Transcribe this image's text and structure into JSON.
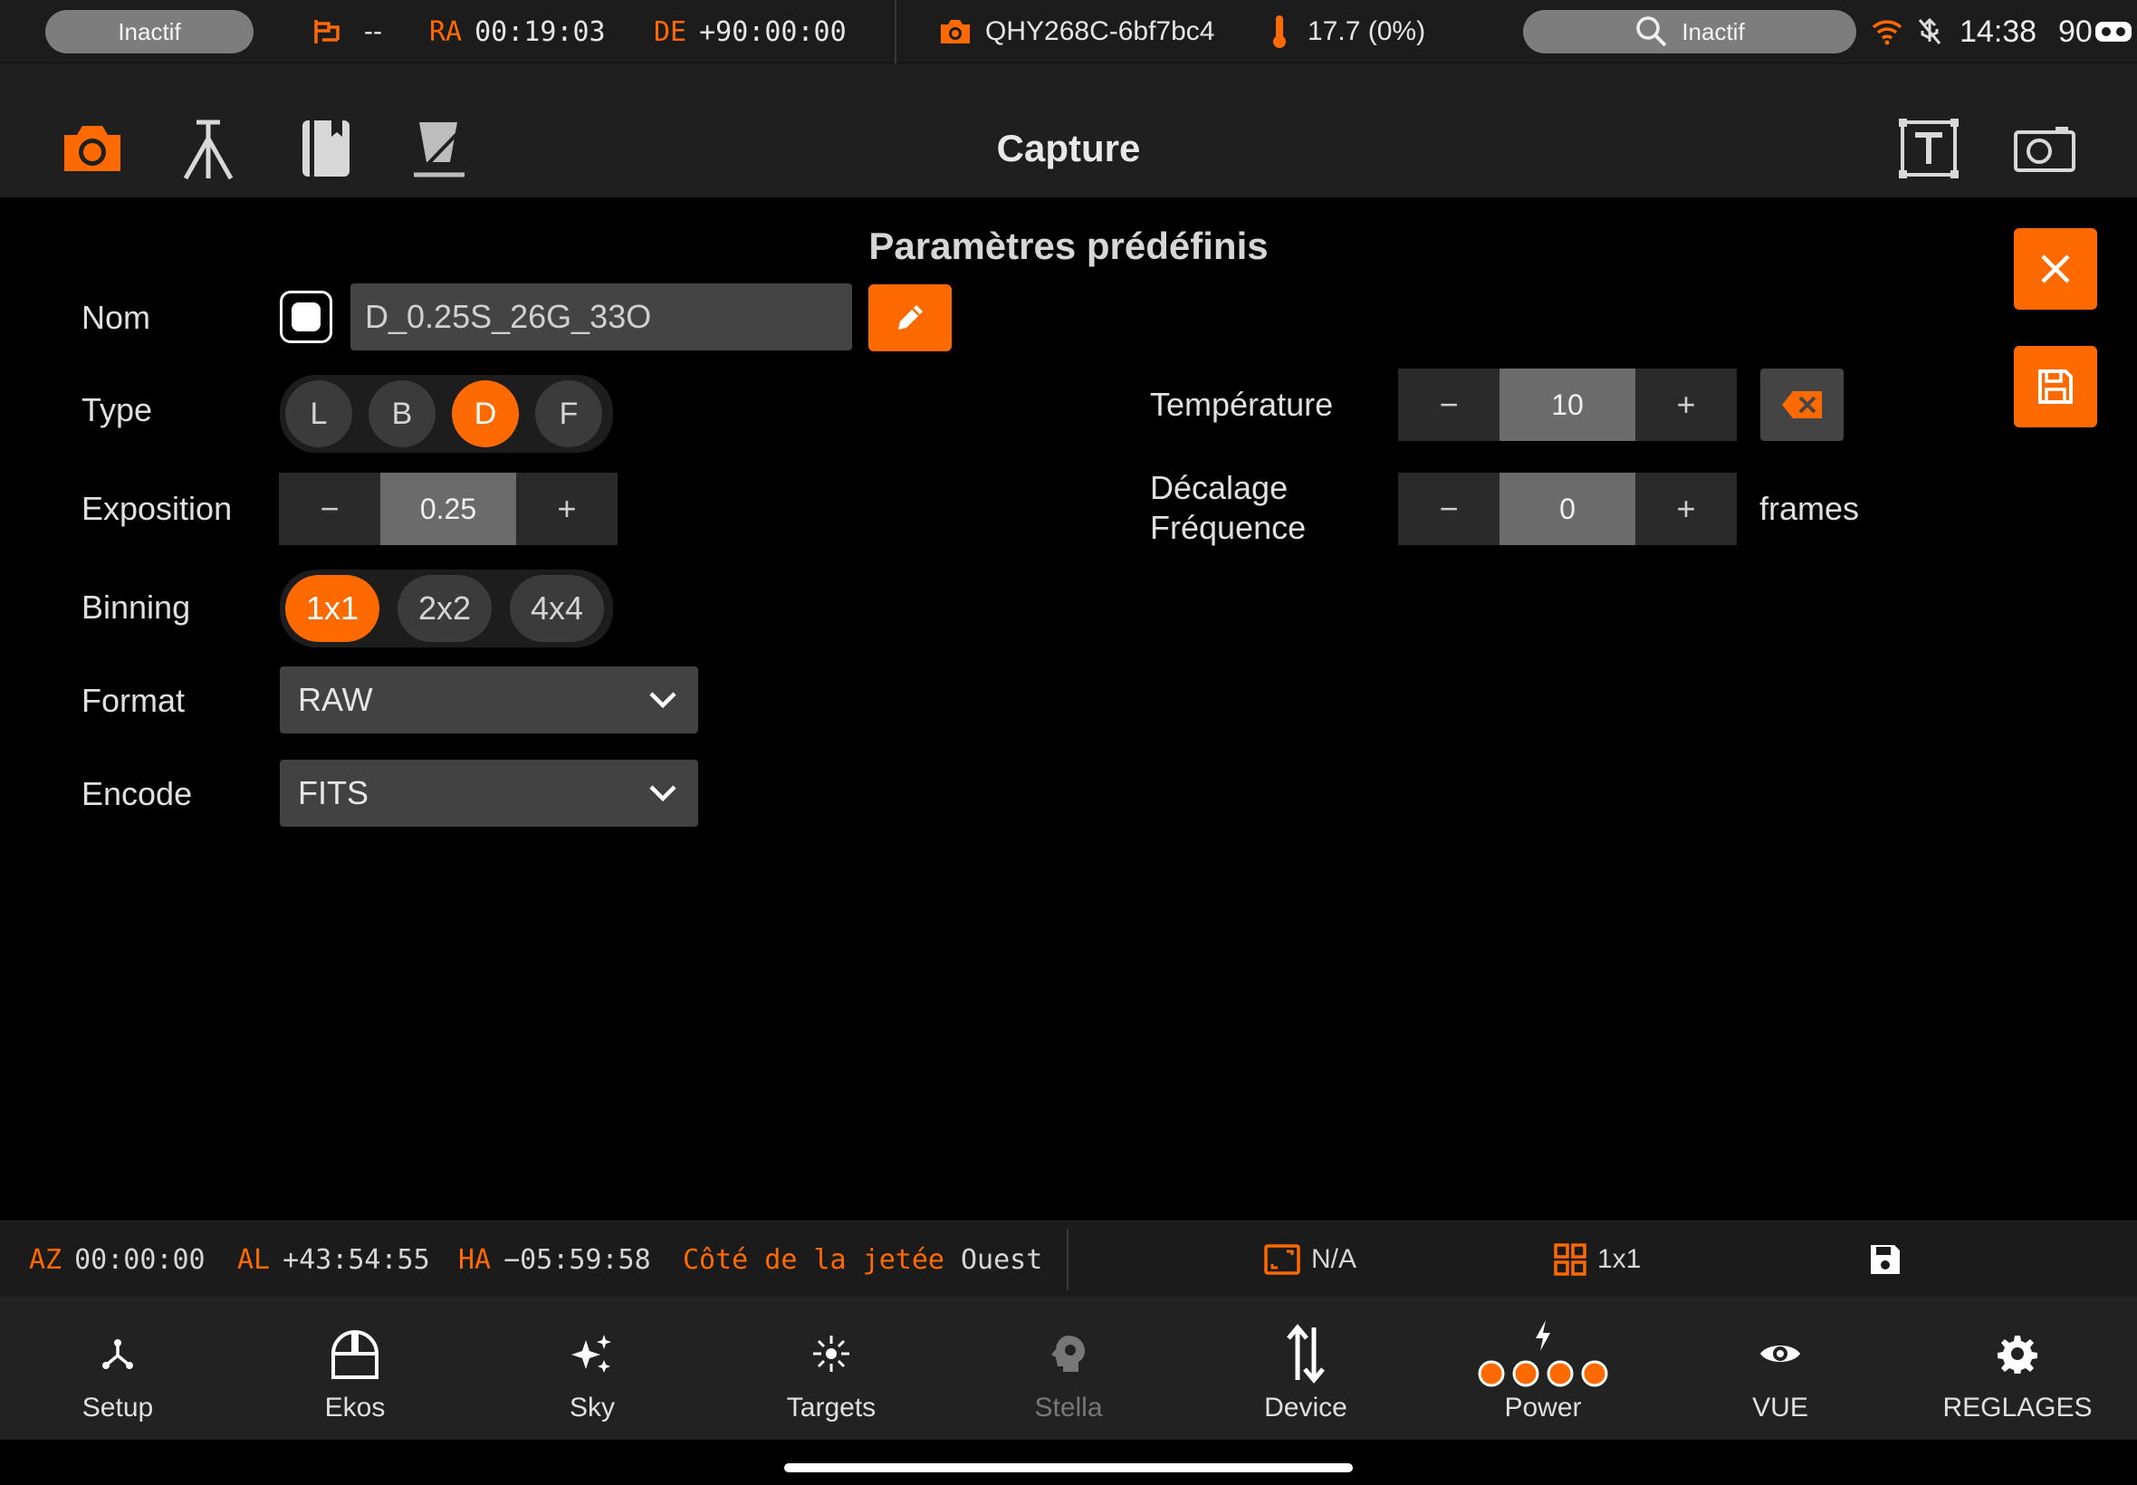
{
  "status_bar": {
    "left_pill": "Inactif",
    "mount_icon": "mount-park-icon",
    "mount_status": "--",
    "ra_label": "RA",
    "ra_value": "00:19:03",
    "de_label": "DE",
    "de_value": "+90:00:00",
    "camera_name": "QHY268C-6bf7bc4",
    "temperature": "17.7 (0%)",
    "right_pill": "Inactif",
    "time": "14:38",
    "battery": "90"
  },
  "header": {
    "title": "Capture",
    "tabs": [
      "camera-icon",
      "tripod-icon",
      "book-icon",
      "flat-panel-icon"
    ],
    "right_icons": [
      "text-frame-icon",
      "camera-outline-icon"
    ]
  },
  "panel": {
    "title": "Paramètres prédéfinis",
    "name_label": "Nom",
    "name_value": "D_0.25S_26G_33O",
    "type_label": "Type",
    "types": [
      "L",
      "B",
      "D",
      "F"
    ],
    "type_selected": "D",
    "exposure_label": "Exposition",
    "exposure_value": "0.25",
    "binning_label": "Binning",
    "binning_options": [
      "1x1",
      "2x2",
      "4x4"
    ],
    "binning_selected": "1x1",
    "format_label": "Format",
    "format_value": "RAW",
    "encode_label": "Encode",
    "encode_value": "FITS",
    "temperature_label": "Température",
    "temperature_value": "10",
    "offset_label_1": "Décalage",
    "offset_label_2": "Fréquence",
    "offset_value": "0",
    "offset_unit": "frames",
    "minus": "−",
    "plus": "+"
  },
  "info_bar": {
    "az_label": "AZ",
    "az_value": "00:00:00",
    "al_label": "AL",
    "al_value": "+43:54:55",
    "ha_label": "HA",
    "ha_value": "−05:59:58",
    "pier_label": "Côté de la jetée",
    "pier_value": "Ouest",
    "frame_value": "N/A",
    "bin_value": "1x1"
  },
  "tab_bar": {
    "items": [
      "Setup",
      "Ekos",
      "Sky",
      "Targets",
      "Stella",
      "Device",
      "Power",
      "VUE",
      "REGLAGES"
    ]
  },
  "colors": {
    "accent": "#ff6a00",
    "background": "#000000",
    "bar": "#1f1f1f"
  }
}
